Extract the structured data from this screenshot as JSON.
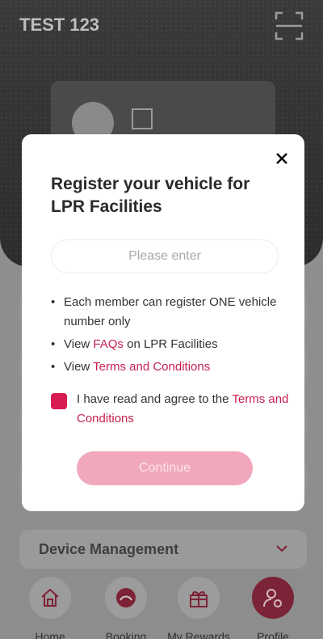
{
  "app": {
    "title": "TEST 123"
  },
  "modal": {
    "title": "Register your vehicle for LPR Facilities",
    "input_placeholder": "Please enter",
    "bullet_1": "Each member can register ONE vehicle number only",
    "bullet_2_prefix": "View ",
    "bullet_2_link": "FAQs",
    "bullet_2_suffix": " on LPR Facilities",
    "bullet_3_prefix": "View ",
    "bullet_3_link": "Terms and Conditions",
    "agree_prefix": "I have read and agree to the ",
    "agree_link": "Terms and Conditions",
    "continue_label": "Continue"
  },
  "background": {
    "device_management_label": "Device Management"
  },
  "nav": {
    "items": [
      {
        "label": "Home",
        "icon": "home-icon"
      },
      {
        "label": "Booking",
        "icon": "booking-icon"
      },
      {
        "label": "My Rewards",
        "icon": "rewards-icon"
      },
      {
        "label": "Profile",
        "icon": "profile-icon",
        "active": true
      }
    ]
  },
  "colors": {
    "accent": "#c8204f",
    "checkbox": "#d81b53",
    "continue_disabled": "#f1a8bd",
    "active_nav": "#7b2438"
  }
}
